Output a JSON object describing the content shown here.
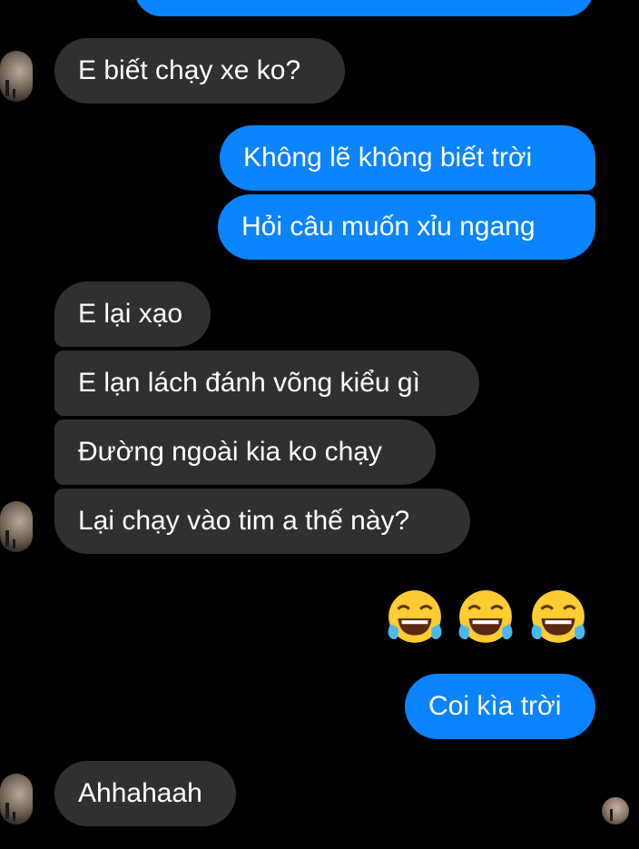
{
  "messages": {
    "msg1": "E biết chạy xe ko?",
    "msg2": "Không lẽ không biết trời",
    "msg3": "Hỏi câu muốn xỉu ngang",
    "msg4": "E lại xạo",
    "msg5": "E lạn lách đánh võng kiểu gì",
    "msg6": "Đường ngoài kia ko chạy",
    "msg7": "Lại chạy vào tim a thế này?",
    "msg9": "Coi kìa trời",
    "msg10": "Ahhahaah"
  },
  "emoji_message": {
    "icon_name": "face-with-tears-of-joy-icon",
    "count": 3
  },
  "colors": {
    "background": "#000000",
    "incoming_bubble": "#303030",
    "outgoing_bubble": "#0a84ff",
    "text": "#ffffff"
  }
}
